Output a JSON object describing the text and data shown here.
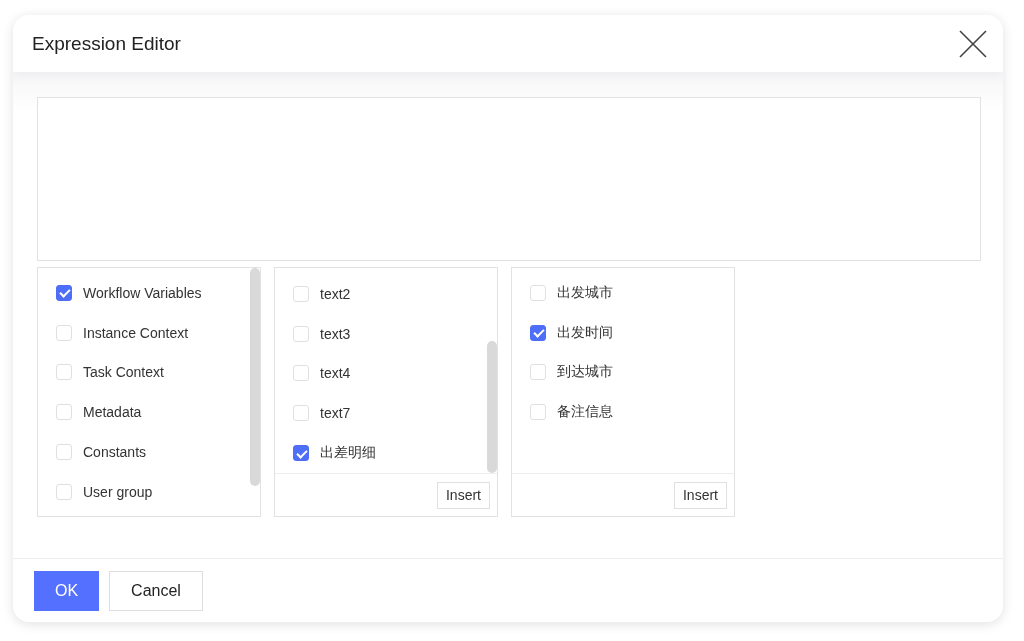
{
  "dialog": {
    "title": "Expression Editor"
  },
  "panels": [
    {
      "items": [
        {
          "label": "Workflow Variables",
          "checked": true
        },
        {
          "label": "Instance Context",
          "checked": false
        },
        {
          "label": "Task Context",
          "checked": false
        },
        {
          "label": "Metadata",
          "checked": false
        },
        {
          "label": "Constants",
          "checked": false
        },
        {
          "label": "User group",
          "checked": false
        }
      ]
    },
    {
      "items": [
        {
          "label": "text2",
          "checked": false
        },
        {
          "label": "text3",
          "checked": false
        },
        {
          "label": "text4",
          "checked": false
        },
        {
          "label": "text7",
          "checked": false
        },
        {
          "label": "出差明细",
          "checked": true
        }
      ],
      "action": "Insert"
    },
    {
      "items": [
        {
          "label": "出发城市",
          "checked": false
        },
        {
          "label": "出发时间",
          "checked": true
        },
        {
          "label": "到达城市",
          "checked": false
        },
        {
          "label": "备注信息",
          "checked": false
        }
      ],
      "action": "Insert"
    }
  ],
  "buttons": [
    {
      "label": "OK",
      "kind": "primary"
    },
    {
      "label": "Cancel",
      "kind": "default"
    }
  ]
}
